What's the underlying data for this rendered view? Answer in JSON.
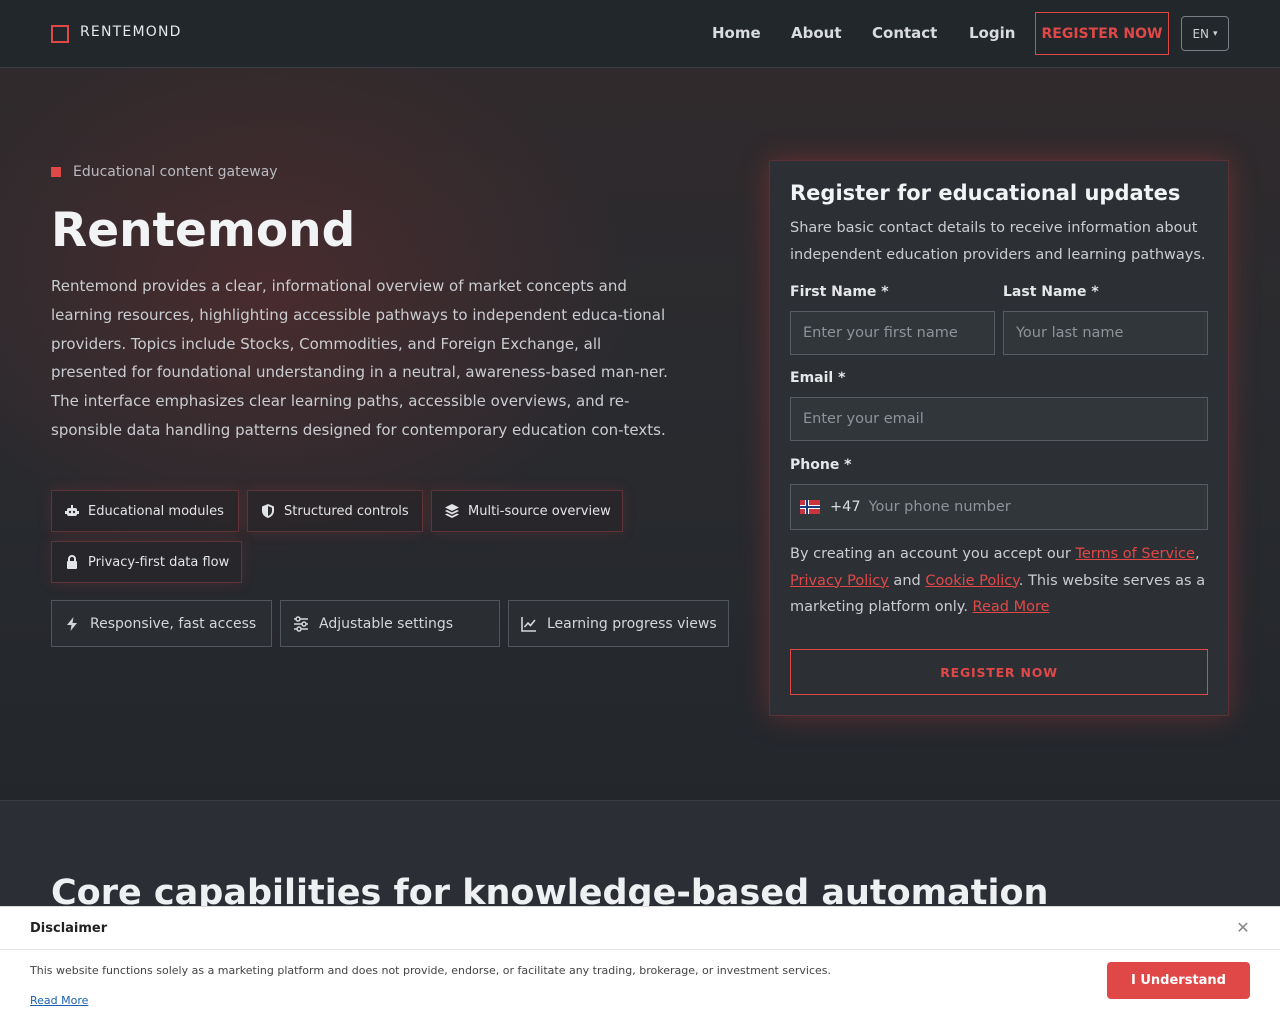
{
  "nav": {
    "brand": "RENTEMOND",
    "links": [
      "Home",
      "About",
      "Contact",
      "Login"
    ],
    "cta": "REGISTER NOW",
    "lang": "EN",
    "lang_arrow": "▾"
  },
  "hero": {
    "eyebrow": "Educational content gateway",
    "title": "Rentemond",
    "description": "Rentemond provides a clear, informational overview of market concepts and learning resources, highlighting accessible pathways to independent educa-tional providers. Topics include Stocks, Commodities, and Foreign Exchange, all presented for foundational understanding in a neutral, awareness-based man-ner. The interface emphasizes clear learning paths, accessible overviews, and re-sponsible data handling patterns designed for contemporary education con-texts.",
    "chips": [
      {
        "label": "Educational modules",
        "icon": "robot-icon"
      },
      {
        "label": "Structured controls",
        "icon": "shield-icon"
      },
      {
        "label": "Multi-source overview",
        "icon": "layers-icon"
      },
      {
        "label": "Privacy-first data flow",
        "icon": "lock-icon"
      }
    ],
    "features": [
      {
        "label": "Responsive, fast access",
        "icon": "bolt-icon"
      },
      {
        "label": "Adjustable settings",
        "icon": "sliders-icon"
      },
      {
        "label": "Learning progress views",
        "icon": "chart-line-icon"
      }
    ]
  },
  "form": {
    "title": "Register for educational updates",
    "subtitle": "Share basic contact details to receive information about independent education providers and learning pathways.",
    "first_name_label": "First Name *",
    "first_name_placeholder": "Enter your first name",
    "last_name_label": "Last Name *",
    "last_name_placeholder": "Your last name",
    "email_label": "Email *",
    "email_placeholder": "Enter your email",
    "phone_label": "Phone *",
    "phone_code": "+47",
    "phone_placeholder": "Your phone number",
    "terms_prefix": "By creating an account you accept our ",
    "terms_link": "Terms of Service",
    "terms_comma": ",",
    "privacy_link": "Privacy Policy",
    "and_text": " and ",
    "cookie_link": "Cookie Policy",
    "terms_suffix": ". This website serves as a marketing platform only. ",
    "read_more": "Read More",
    "submit": "REGISTER NOW"
  },
  "section2": {
    "title": "Core capabilities for knowledge-based automation"
  },
  "disclaimer": {
    "title": "Disclaimer",
    "close": "✕",
    "text": "This website functions solely as a marketing platform and does not provide, endorse, or facilitate any trading, brokerage, or investment services.",
    "read_more": "Read More",
    "button": "I Understand"
  },
  "colors": {
    "accent": "#e04848",
    "background": "#262a2f",
    "card": "#2c3035"
  }
}
